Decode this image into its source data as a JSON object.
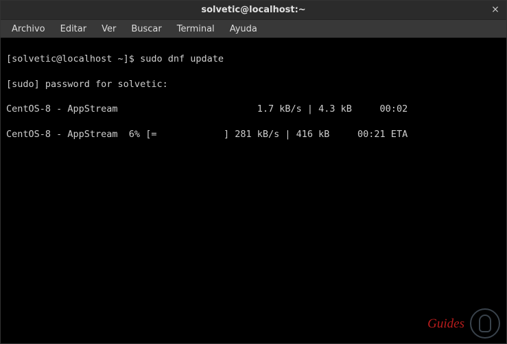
{
  "window": {
    "title": "solvetic@localhost:~",
    "close_label": "×"
  },
  "menubar": {
    "items": [
      "Archivo",
      "Editar",
      "Ver",
      "Buscar",
      "Terminal",
      "Ayuda"
    ]
  },
  "terminal": {
    "lines": [
      "[solvetic@localhost ~]$ sudo dnf update",
      "[sudo] password for solvetic:",
      "CentOS-8 - AppStream                         1.7 kB/s | 4.3 kB     00:02",
      "CentOS-8 - AppStream  6% [=            ] 281 kB/s | 416 kB     00:21 ETA"
    ]
  },
  "watermark": {
    "text": "Guides"
  }
}
